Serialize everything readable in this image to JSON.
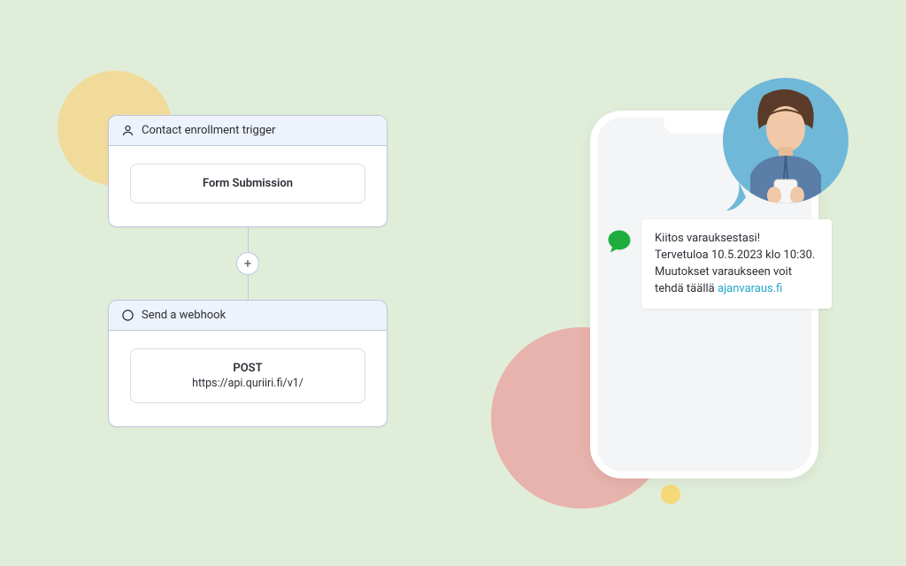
{
  "workflow": {
    "trigger": {
      "title": "Contact enrollment trigger",
      "content": "Form Submission"
    },
    "action": {
      "title": "Send a webhook",
      "method": "POST",
      "url": "https://api.quriiri.fi/v1/"
    },
    "add_button": "+"
  },
  "sms": {
    "line1": "Kiitos varauksestasi!",
    "line2": "Tervetuloa 10.5.2023 klo 10:30.",
    "line3": "Muutokset varaukseen voit tehdä täällä ",
    "link": "ajanvaraus.fi"
  }
}
